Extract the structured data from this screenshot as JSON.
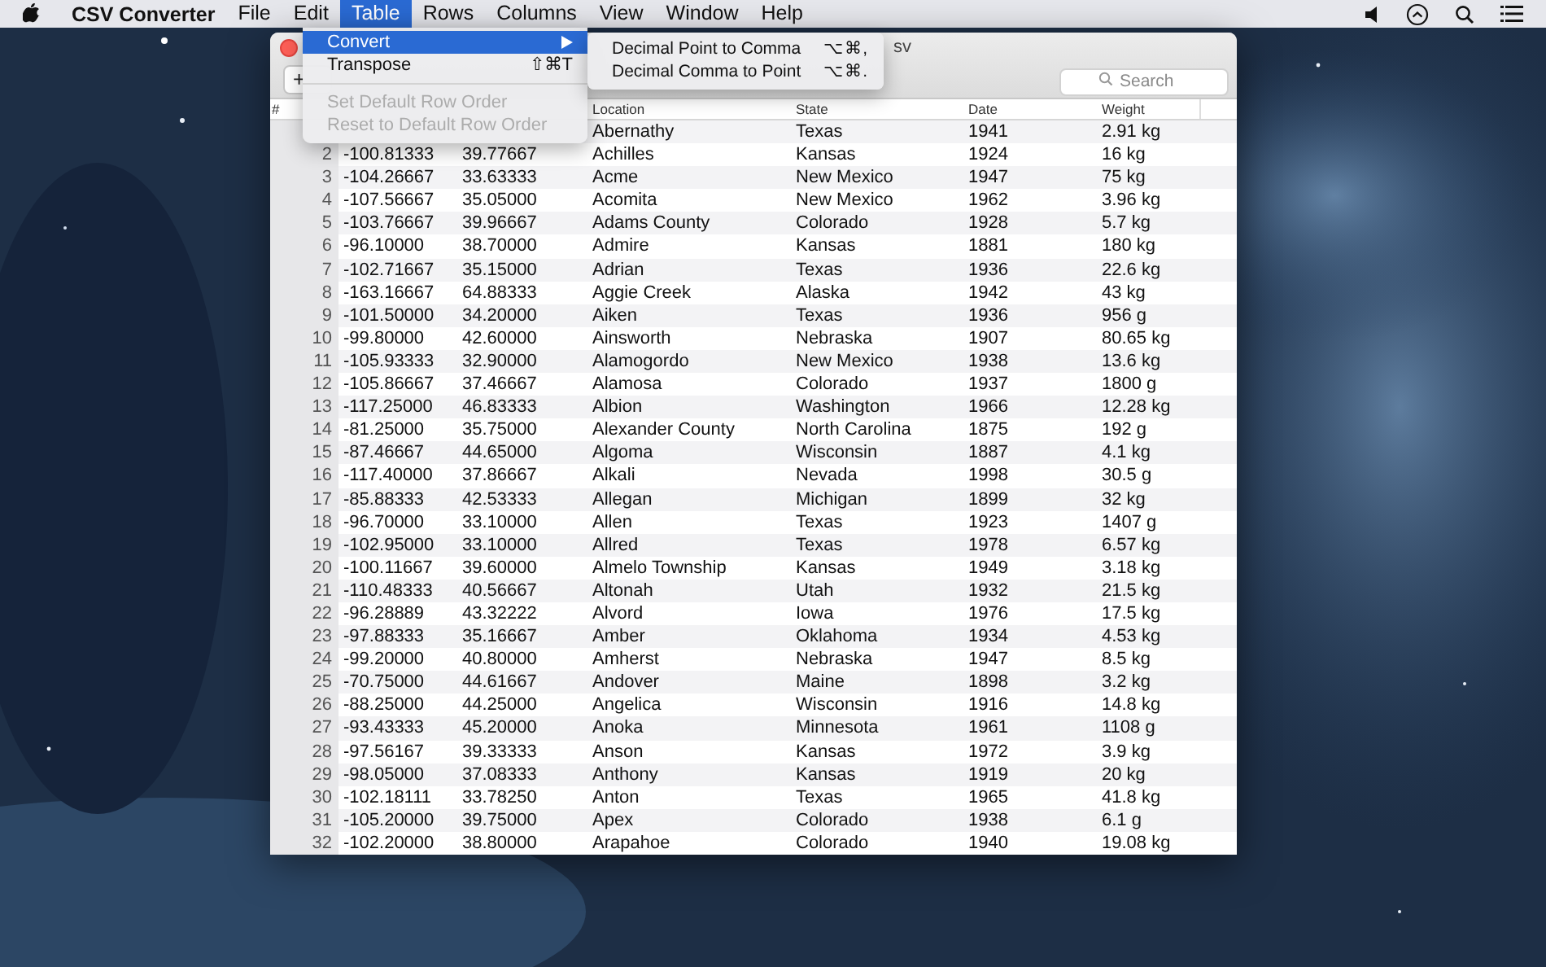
{
  "menu_bar": {
    "app_name": "CSV Converter",
    "menus": [
      {
        "label": "File",
        "selected": false
      },
      {
        "label": "Edit",
        "selected": false
      },
      {
        "label": "Table",
        "selected": true
      },
      {
        "label": "Rows",
        "selected": false
      },
      {
        "label": "Columns",
        "selected": false
      },
      {
        "label": "View",
        "selected": false
      },
      {
        "label": "Window",
        "selected": false
      },
      {
        "label": "Help",
        "selected": false
      }
    ]
  },
  "window": {
    "title": "sv",
    "add_button": "+",
    "search": {
      "placeholder": "Search"
    },
    "table": {
      "header": {
        "number": "#",
        "location": "Location",
        "state": "State",
        "date": "Date",
        "weight": "Weight"
      },
      "rows": [
        {
          "location": "Abernathy",
          "state": "Texas",
          "date": "1941",
          "weight": "2.91 kg"
        },
        {
          "number": "2",
          "column_2": "-100.81333",
          "column_3": "39.77667",
          "location": "Achilles",
          "state": "Kansas",
          "date": "1924",
          "weight": "16 kg"
        },
        {
          "number": "3",
          "column_2": "-104.26667",
          "column_3": "33.63333",
          "location": "Acme",
          "state": "New Mexico",
          "date": "1947",
          "weight": "75 kg"
        },
        {
          "number": "4",
          "column_2": "-107.56667",
          "column_3": "35.05000",
          "location": "Acomita",
          "state": "New Mexico",
          "date": "1962",
          "weight": "3.96 kg"
        },
        {
          "number": "5",
          "column_2": "-103.76667",
          "column_3": "39.96667",
          "location": "Adams County",
          "state": "Colorado",
          "date": "1928",
          "weight": "5.7 kg"
        },
        {
          "number": "6",
          "column_2": "-96.10000",
          "column_3": "38.70000",
          "location": "Admire",
          "state": "Kansas",
          "date": "1881",
          "weight": "180 kg"
        },
        {
          "number": "7",
          "column_2": "-102.71667",
          "column_3": "35.15000",
          "location": "Adrian",
          "state": "Texas",
          "date": "1936",
          "weight": "22.6 kg"
        },
        {
          "number": "8",
          "column_2": "-163.16667",
          "column_3": "64.88333",
          "location": "Aggie Creek",
          "state": "Alaska",
          "date": "1942",
          "weight": "43 kg"
        },
        {
          "number": "9",
          "column_2": "-101.50000",
          "column_3": "34.20000",
          "location": "Aiken",
          "state": "Texas",
          "date": "1936",
          "weight": "956 g"
        },
        {
          "number": "10",
          "column_2": "-99.80000",
          "column_3": "42.60000",
          "location": "Ainsworth",
          "state": "Nebraska",
          "date": "1907",
          "weight": "80.65 kg"
        },
        {
          "number": "11",
          "column_2": "-105.93333",
          "column_3": "32.90000",
          "location": "Alamogordo",
          "state": "New Mexico",
          "date": "1938",
          "weight": "13.6 kg"
        },
        {
          "number": "12",
          "column_2": "-105.86667",
          "column_3": "37.46667",
          "location": "Alamosa",
          "state": "Colorado",
          "date": "1937",
          "weight": "1800 g"
        },
        {
          "number": "13",
          "column_2": "-117.25000",
          "column_3": "46.83333",
          "location": "Albion",
          "state": "Washington",
          "date": "1966",
          "weight": "12.28 kg"
        },
        {
          "number": "14",
          "column_2": "-81.25000",
          "column_3": "35.75000",
          "location": "Alexander County",
          "state": "North Carolina",
          "date": "1875",
          "weight": "192 g"
        },
        {
          "number": "15",
          "column_2": "-87.46667",
          "column_3": "44.65000",
          "location": "Algoma",
          "state": "Wisconsin",
          "date": "1887",
          "weight": "4.1 kg"
        },
        {
          "number": "16",
          "column_2": "-117.40000",
          "column_3": "37.86667",
          "location": "Alkali",
          "state": "Nevada",
          "date": "1998",
          "weight": "30.5 g"
        },
        {
          "number": "17",
          "column_2": "-85.88333",
          "column_3": "42.53333",
          "location": "Allegan",
          "state": "Michigan",
          "date": "1899",
          "weight": "32 kg"
        },
        {
          "number": "18",
          "column_2": "-96.70000",
          "column_3": "33.10000",
          "location": "Allen",
          "state": "Texas",
          "date": "1923",
          "weight": "1407 g"
        },
        {
          "number": "19",
          "column_2": "-102.95000",
          "column_3": "33.10000",
          "location": "Allred",
          "state": "Texas",
          "date": "1978",
          "weight": "6.57 kg"
        },
        {
          "number": "20",
          "column_2": "-100.11667",
          "column_3": "39.60000",
          "location": "Almelo Township",
          "state": "Kansas",
          "date": "1949",
          "weight": "3.18 kg"
        },
        {
          "number": "21",
          "column_2": "-110.48333",
          "column_3": "40.56667",
          "location": "Altonah",
          "state": "Utah",
          "date": "1932",
          "weight": "21.5 kg"
        },
        {
          "number": "22",
          "column_2": "-96.28889",
          "column_3": "43.32222",
          "location": "Alvord",
          "state": "Iowa",
          "date": "1976",
          "weight": "17.5 kg"
        },
        {
          "number": "23",
          "column_2": "-97.88333",
          "column_3": "35.16667",
          "location": "Amber",
          "state": "Oklahoma",
          "date": "1934",
          "weight": "4.53 kg"
        },
        {
          "number": "24",
          "column_2": "-99.20000",
          "column_3": "40.80000",
          "location": "Amherst",
          "state": "Nebraska",
          "date": "1947",
          "weight": "8.5 kg"
        },
        {
          "number": "25",
          "column_2": "-70.75000",
          "column_3": "44.61667",
          "location": "Andover",
          "state": "Maine",
          "date": "1898",
          "weight": "3.2 kg"
        },
        {
          "number": "26",
          "column_2": "-88.25000",
          "column_3": "44.25000",
          "location": "Angelica",
          "state": "Wisconsin",
          "date": "1916",
          "weight": "14.8 kg"
        },
        {
          "number": "27",
          "column_2": "-93.43333",
          "column_3": "45.20000",
          "location": "Anoka",
          "state": "Minnesota",
          "date": "1961",
          "weight": "1108 g"
        },
        {
          "number": "28",
          "column_2": "-97.56167",
          "column_3": "39.33333",
          "location": "Anson",
          "state": "Kansas",
          "date": "1972",
          "weight": "3.9 kg"
        },
        {
          "number": "29",
          "column_2": "-98.05000",
          "column_3": "37.08333",
          "location": "Anthony",
          "state": "Kansas",
          "date": "1919",
          "weight": "20 kg"
        },
        {
          "number": "30",
          "column_2": "-102.18111",
          "column_3": "33.78250",
          "location": "Anton",
          "state": "Texas",
          "date": "1965",
          "weight": "41.8 kg"
        },
        {
          "number": "31",
          "column_2": "-105.20000",
          "column_3": "39.75000",
          "location": "Apex",
          "state": "Colorado",
          "date": "1938",
          "weight": "6.1 g"
        },
        {
          "number": "32",
          "column_2": "-102.20000",
          "column_3": "38.80000",
          "location": "Arapahoe",
          "state": "Colorado",
          "date": "1940",
          "weight": "19.08 kg"
        }
      ]
    }
  },
  "table_menu": {
    "items": [
      {
        "kind": "submenu",
        "label": "Convert",
        "selected": true,
        "disabled": false
      },
      {
        "kind": "command",
        "label": "Transpose",
        "shortcut": "⇧⌘T",
        "selected": false,
        "disabled": false
      },
      {
        "kind": "separator"
      },
      {
        "kind": "command",
        "label": "Set Default Row Order",
        "selected": false,
        "disabled": true
      },
      {
        "kind": "command",
        "label": "Reset to Default Row Order",
        "selected": false,
        "disabled": true
      }
    ]
  },
  "convert_submenu": {
    "items": [
      {
        "label": "Decimal Point to Comma",
        "shortcut": "⌥⌘,"
      },
      {
        "label": "Decimal Comma to Point",
        "shortcut": "⌥⌘."
      }
    ]
  }
}
